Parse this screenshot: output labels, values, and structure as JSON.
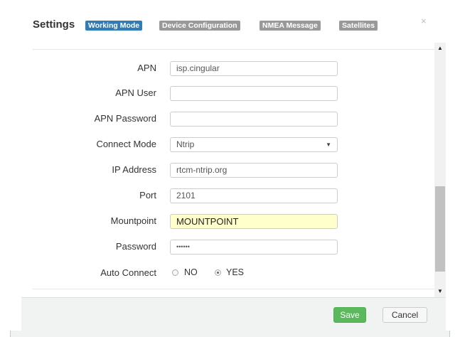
{
  "dialog": {
    "title": "Settings",
    "close_glyph": "×",
    "tabs": [
      {
        "label": "Working Mode",
        "active": true,
        "color": "#2f7db8"
      },
      {
        "label": "Device Configuration",
        "active": false,
        "color": "#999999"
      },
      {
        "label": "NMEA Message",
        "active": false,
        "color": "#999999"
      },
      {
        "label": "Satellites",
        "active": false,
        "color": "#999999"
      }
    ]
  },
  "form": {
    "apn": {
      "label": "APN",
      "value": "isp.cingular"
    },
    "apn_user": {
      "label": "APN User",
      "value": ""
    },
    "apn_password": {
      "label": "APN Password",
      "value": ""
    },
    "connect_mode": {
      "label": "Connect Mode",
      "value": "Ntrip"
    },
    "ip_address": {
      "label": "IP Address",
      "value": "rtcm-ntrip.org"
    },
    "port": {
      "label": "Port",
      "value": "2101"
    },
    "mountpoint": {
      "label": "Mountpoint",
      "value": "MOUNTPOINT"
    },
    "password": {
      "label": "Password",
      "value": "••••••"
    },
    "auto_connect": {
      "label": "Auto Connect",
      "options": [
        "NO",
        "YES"
      ],
      "selected": "YES"
    }
  },
  "footer": {
    "save_label": "Save",
    "cancel_label": "Cancel",
    "save_color": "#5cb85c"
  },
  "icons": {
    "scroll_up": "▲",
    "scroll_down": "▼",
    "select_caret": "▼"
  }
}
